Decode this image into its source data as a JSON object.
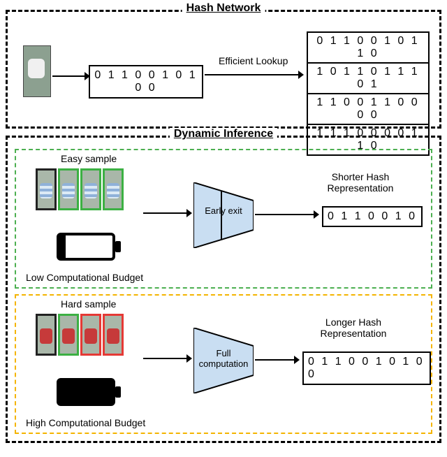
{
  "hash_network": {
    "title": "Hash Network",
    "query_hash": "0 1 1 0 0 1 0 1 0 0",
    "lookup_label": "Efficient Lookup",
    "lookup_rows": [
      "0 1 1 0 0 1 0 1 1 0",
      "1 0 1 1 0 1 1 1 0 1",
      "1 1 0 0 1 1 0 0 0 0",
      "1 1 1 0 0 0 0 1 1 0"
    ]
  },
  "dynamic_inference": {
    "title": "Dynamic Inference",
    "easy": {
      "label": "Easy sample",
      "budget_label": "Low Computational Budget",
      "trap_label": "Early exit",
      "rep_label": "Shorter Hash Representation",
      "rep_value": "0 1 1 0 0 1 0"
    },
    "hard": {
      "label": "Hard sample",
      "budget_label": "High Computational Budget",
      "trap_label": "Full computation",
      "rep_label": "Longer Hash Representation",
      "rep_value": "0 1 1 0 0 1 0 1 0 0"
    }
  }
}
